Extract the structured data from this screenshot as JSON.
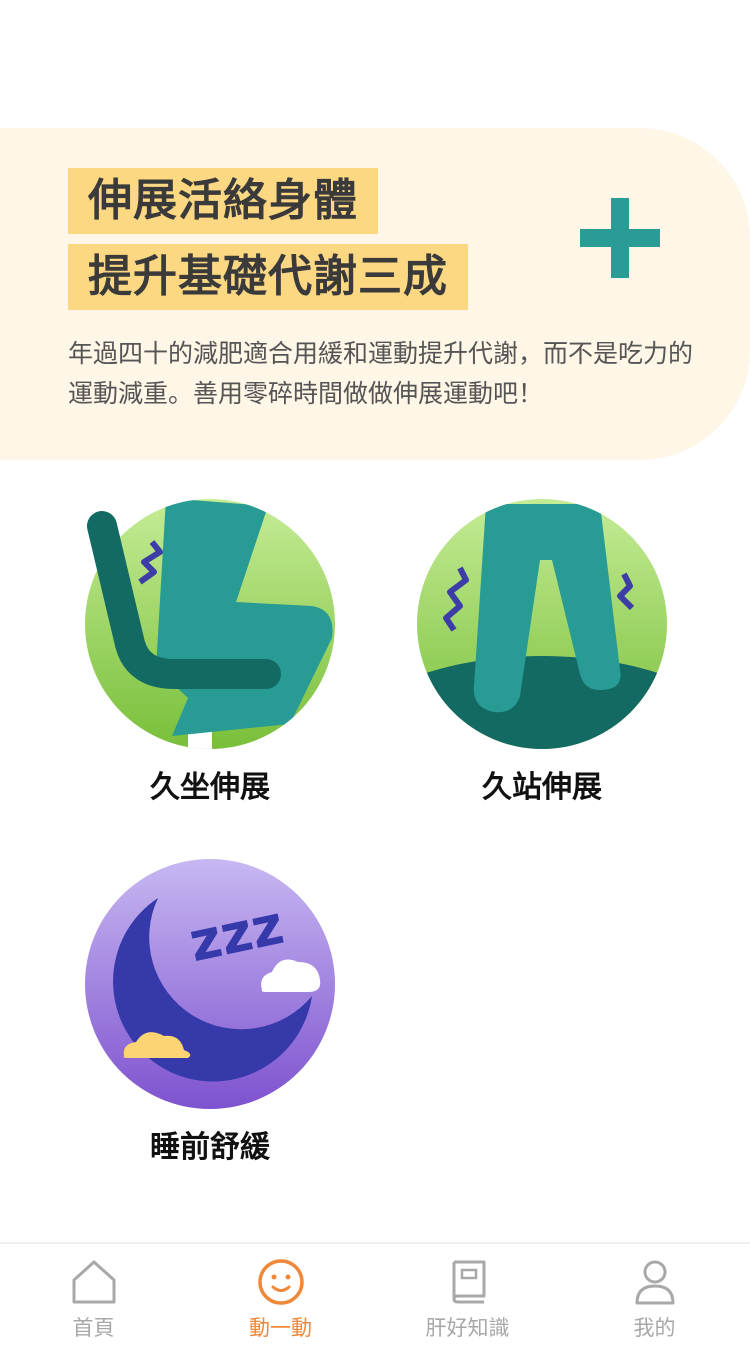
{
  "hero": {
    "title_line1": "伸展活絡身體",
    "title_line2": "提升基礎代謝三成",
    "description": "年過四十的減肥適合用緩和運動提升代謝，而不是吃力的運動減重。善用零碎時間做做伸展運動吧！",
    "icon": "plus-icon",
    "accent_color": "#2a9c96",
    "highlight_color": "#fcd883",
    "background_color": "#fef6e6"
  },
  "exercises": [
    {
      "label": "久坐伸展",
      "icon": "sitting-leg-icon"
    },
    {
      "label": "久站伸展",
      "icon": "standing-legs-icon"
    },
    {
      "label": "睡前舒緩",
      "icon": "moon-sleep-icon"
    }
  ],
  "tabbar": {
    "active_color": "#f0883a",
    "inactive_color": "#a8a8a8",
    "tabs": [
      {
        "label": "首頁",
        "icon": "home-icon",
        "active": false
      },
      {
        "label": "動一動",
        "icon": "smiley-icon",
        "active": true
      },
      {
        "label": "肝好知識",
        "icon": "book-icon",
        "active": false
      },
      {
        "label": "我的",
        "icon": "person-icon",
        "active": false
      }
    ]
  }
}
